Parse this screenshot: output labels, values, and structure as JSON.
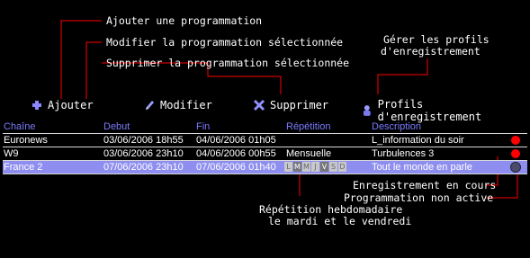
{
  "annotations": {
    "ajouter": "Ajouter une programmation",
    "modifier": "Modifier la programmation sélectionnée",
    "supprimer": "Supprimer la programmation sélectionnée",
    "profils_l1": "Gérer les profils",
    "profils_l2": "d'enregistrement",
    "en_cours": "Enregistrement en cours",
    "non_active": "Programmation non active",
    "repetition_l1": "Répétition hebdomadaire",
    "repetition_l2": "le mardi et le vendredi"
  },
  "toolbar": {
    "add_label": "Ajouter",
    "edit_label": "Modifier",
    "delete_label": "Supprimer",
    "profiles_label": "Profils d'enregistrement",
    "icons": [
      "plus-icon",
      "pencil-icon",
      "cross-icon",
      "profile-icon"
    ]
  },
  "table": {
    "columns": [
      "Chaîne",
      "Debut",
      "Fin",
      "Répétition",
      "Description"
    ],
    "rows": [
      {
        "chaine": "Euronews",
        "debut": "03/06/2006 18h55",
        "fin": "04/06/2006 01h05",
        "repetition": "",
        "description": "L_information du soir",
        "status": "recording"
      },
      {
        "chaine": "W9",
        "debut": "03/06/2006 23h10",
        "fin": "04/06/2006 00h55",
        "repetition": "Mensuelle",
        "description": "Turbulences 3",
        "status": "recording"
      },
      {
        "chaine": "France 2",
        "debut": "07/06/2006 23h10",
        "fin": "07/06/2006 01h40",
        "repetition": "",
        "description": "Tout le monde en parle",
        "status": "inactive"
      }
    ],
    "weekdays": [
      "L",
      "M",
      "M",
      "J",
      "V",
      "S",
      "D"
    ],
    "active_days": [
      1,
      4
    ]
  },
  "colors": {
    "background": "#000000",
    "header_text": "#7b7bff",
    "selected_row": "#8e8ef0",
    "recording": "#ff0000"
  }
}
